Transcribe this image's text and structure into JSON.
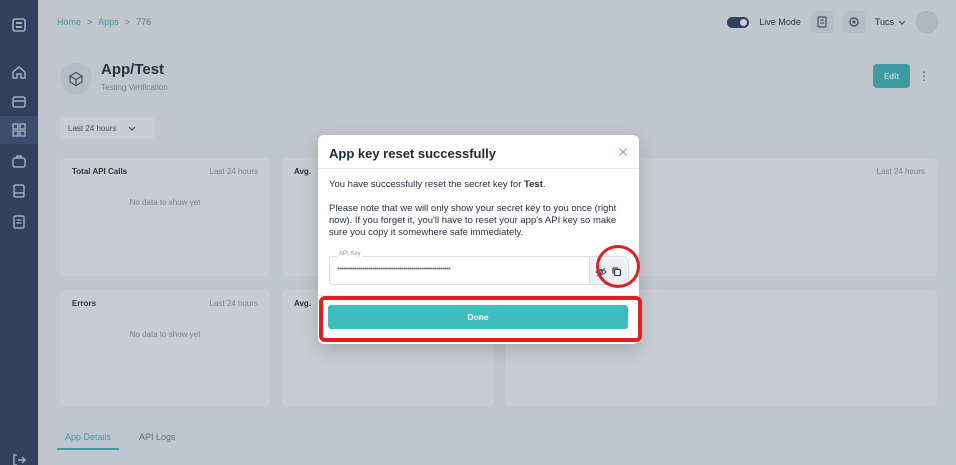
{
  "breadcrumb": {
    "home": "Home",
    "apps": "Apps",
    "current": "776",
    "separator": ">"
  },
  "header": {
    "live_mode_label": "Live Mode",
    "user_name": "Tucs"
  },
  "app": {
    "title": "App/Test",
    "subtitle": "Testing Verification",
    "edit_label": "Edit"
  },
  "filter": {
    "range_label": "Last 24 hours"
  },
  "cards": [
    {
      "title": "Total API Calls",
      "range": "Last 24 hours",
      "empty": "No data to show yet"
    },
    {
      "title": "Avg.",
      "range": "",
      "empty": ""
    },
    {
      "title": "",
      "range": "Last 24 hours",
      "empty": ""
    },
    {
      "title": "Errors",
      "range": "Last 24 hours",
      "empty": "No data to show yet"
    },
    {
      "title": "Avg.",
      "range": "",
      "empty": ""
    }
  ],
  "tabs": [
    {
      "label": "App Details",
      "active": true
    },
    {
      "label": "API Logs",
      "active": false
    }
  ],
  "modal": {
    "title": "App key reset successfully",
    "line1_prefix": "You have successfully reset the secret key for ",
    "line1_app": "Test",
    "line1_suffix": ".",
    "line2": "Please note that we will only show your secret key to you once (right now). If you forget it, you'll have to reset your app's API key so make sure you copy it somewhere safe immediately.",
    "key_label": "API Key",
    "key_value": "••••••••••••••••••••••••••••••••••••••••••••••••••••••••••",
    "done_label": "Done"
  },
  "colors": {
    "accent": "#3dbdbd",
    "sidebar": "#2d3d5c",
    "highlight": "#e02020"
  }
}
